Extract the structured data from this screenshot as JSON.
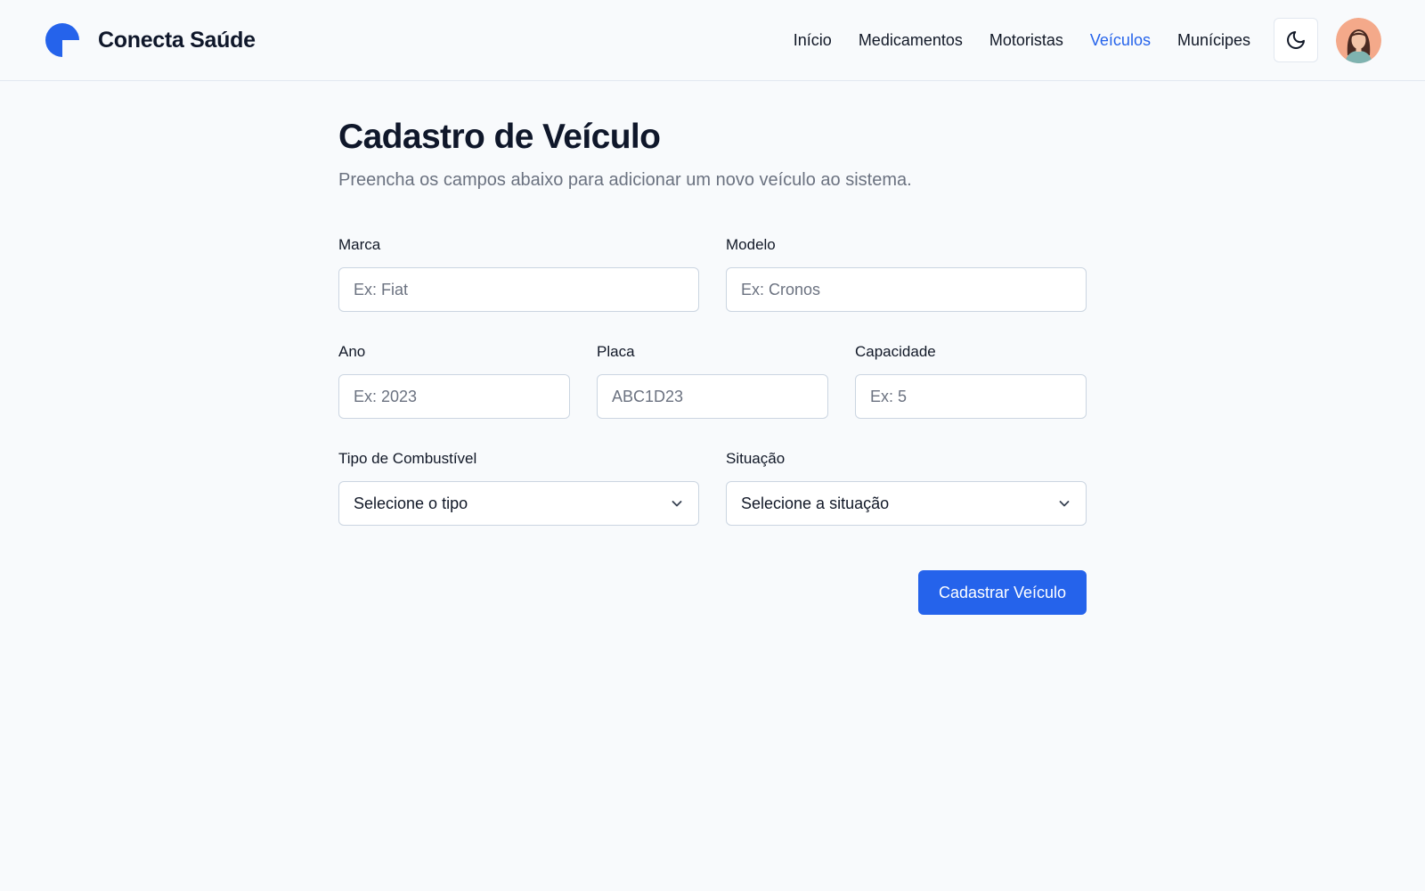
{
  "header": {
    "brand_name": "Conecta Saúde",
    "brand_color": "#2563eb",
    "nav": [
      {
        "label": "Início",
        "active": false
      },
      {
        "label": "Medicamentos",
        "active": false
      },
      {
        "label": "Motoristas",
        "active": false
      },
      {
        "label": "Veículos",
        "active": true
      },
      {
        "label": "Munícipes",
        "active": false
      }
    ],
    "theme_toggle_icon": "moon-icon",
    "avatar_icon": "user-avatar"
  },
  "page": {
    "title": "Cadastro de Veículo",
    "subtitle": "Preencha os campos abaixo para adicionar um novo veículo ao sistema."
  },
  "form": {
    "marca": {
      "label": "Marca",
      "placeholder": "Ex: Fiat",
      "value": ""
    },
    "modelo": {
      "label": "Modelo",
      "placeholder": "Ex: Cronos",
      "value": ""
    },
    "ano": {
      "label": "Ano",
      "placeholder": "Ex: 2023",
      "value": ""
    },
    "placa": {
      "label": "Placa",
      "placeholder": "ABC1D23",
      "value": ""
    },
    "capacidade": {
      "label": "Capacidade",
      "placeholder": "Ex: 5",
      "value": ""
    },
    "combustivel": {
      "label": "Tipo de Combustível",
      "selected": "Selecione o tipo"
    },
    "situacao": {
      "label": "Situação",
      "selected": "Selecione a situação"
    },
    "submit_label": "Cadastrar Veículo"
  },
  "colors": {
    "accent": "#2563eb",
    "background": "#f8fafc",
    "border": "#cbd5e1",
    "muted_text": "#6b7280"
  }
}
